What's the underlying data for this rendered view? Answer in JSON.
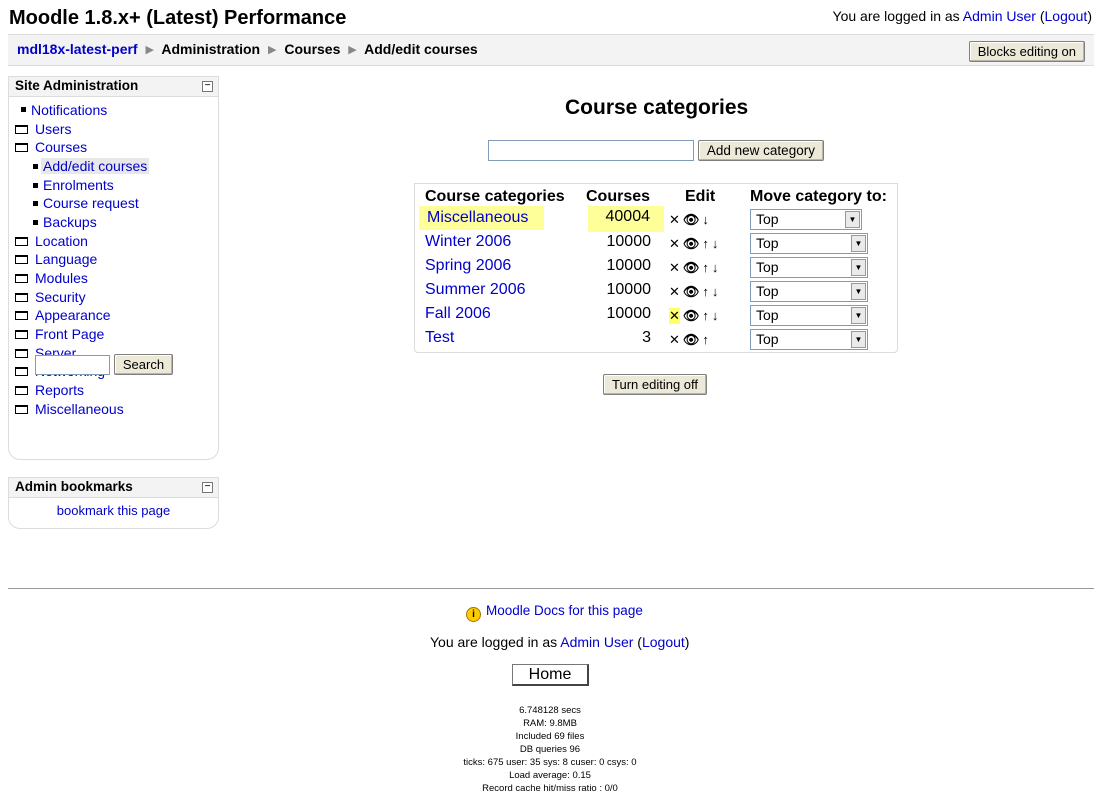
{
  "header": {
    "site_title": "Moodle 1.8.x+ (Latest) Performance",
    "login_prefix": "You are logged in as ",
    "user": "Admin User",
    "logout": "Logout"
  },
  "breadcrumb": {
    "items": [
      "mdl18x-latest-perf",
      "Administration",
      "Courses",
      "Add/edit courses"
    ],
    "separator": "▶"
  },
  "blocks_editing_button": "Blocks editing on",
  "site_admin": {
    "title": "Site Administration",
    "items": [
      {
        "label": "Notifications",
        "icon": "bullet-icon"
      },
      {
        "label": "Users",
        "icon": "folder-icon"
      },
      {
        "label": "Courses",
        "icon": "folder-open-icon"
      },
      {
        "label": "Add/edit courses",
        "icon": "bullet-icon",
        "selected": true
      },
      {
        "label": "Enrolments",
        "icon": "bullet-icon"
      },
      {
        "label": "Course request",
        "icon": "bullet-icon"
      },
      {
        "label": "Backups",
        "icon": "bullet-icon"
      },
      {
        "label": "Location",
        "icon": "folder-icon"
      },
      {
        "label": "Language",
        "icon": "folder-icon"
      },
      {
        "label": "Modules",
        "icon": "folder-icon"
      },
      {
        "label": "Security",
        "icon": "folder-icon"
      },
      {
        "label": "Appearance",
        "icon": "folder-icon"
      },
      {
        "label": "Front Page",
        "icon": "folder-icon"
      },
      {
        "label": "Server",
        "icon": "folder-icon"
      },
      {
        "label": "Networking",
        "icon": "folder-icon"
      },
      {
        "label": "Reports",
        "icon": "folder-icon"
      },
      {
        "label": "Miscellaneous",
        "icon": "folder-icon"
      }
    ],
    "search_button": "Search",
    "search_value": ""
  },
  "bookmarks": {
    "title": "Admin bookmarks",
    "link": "bookmark this page"
  },
  "main": {
    "title": "Course categories",
    "new_category_value": "",
    "add_button": "Add new category",
    "columns": [
      "Course categories",
      "Courses",
      "Edit",
      "Move category to:"
    ],
    "rows": [
      {
        "name": "Miscellaneous",
        "courses": "40004",
        "move_to": "Top",
        "icons": [
          "delete-icon",
          "show-icon",
          "move-down-icon"
        ],
        "highlight": true
      },
      {
        "name": "Winter 2006",
        "courses": "10000",
        "move_to": "Top",
        "icons": [
          "delete-icon",
          "show-icon",
          "move-up-icon",
          "move-down-icon"
        ]
      },
      {
        "name": "Spring 2006",
        "courses": "10000",
        "move_to": "Top",
        "icons": [
          "delete-icon",
          "show-icon",
          "move-up-icon",
          "move-down-icon"
        ]
      },
      {
        "name": "Summer 2006",
        "courses": "10000",
        "move_to": "Top",
        "icons": [
          "delete-icon",
          "show-icon",
          "move-up-icon",
          "move-down-icon"
        ]
      },
      {
        "name": "Fall 2006",
        "courses": "10000",
        "move_to": "Top",
        "icons": [
          "delete-icon",
          "show-icon",
          "move-up-icon",
          "move-down-icon"
        ],
        "highlight_delete": true
      },
      {
        "name": "Test",
        "courses": "3",
        "move_to": "Top",
        "icons": [
          "delete-icon",
          "show-icon",
          "move-up-icon"
        ]
      }
    ],
    "turn_editing_off": "Turn editing off"
  },
  "colors": {
    "link": "#0000cc",
    "highlight": "#ffff99",
    "header_bg": "#f3f3f3"
  },
  "footer": {
    "docs_link": "Moodle Docs for this page",
    "login_prefix": "You are logged in as ",
    "user": "Admin User",
    "logout": "Logout",
    "home_button": "Home",
    "perf": [
      "6.748128 secs",
      "RAM: 9.8MB",
      "Included 69 files",
      "DB queries 96",
      "ticks: 675 user: 35 sys: 8 cuser: 0 csys: 0",
      "Load average: 0.15",
      "Record cache hit/miss ratio : 0/0"
    ]
  }
}
